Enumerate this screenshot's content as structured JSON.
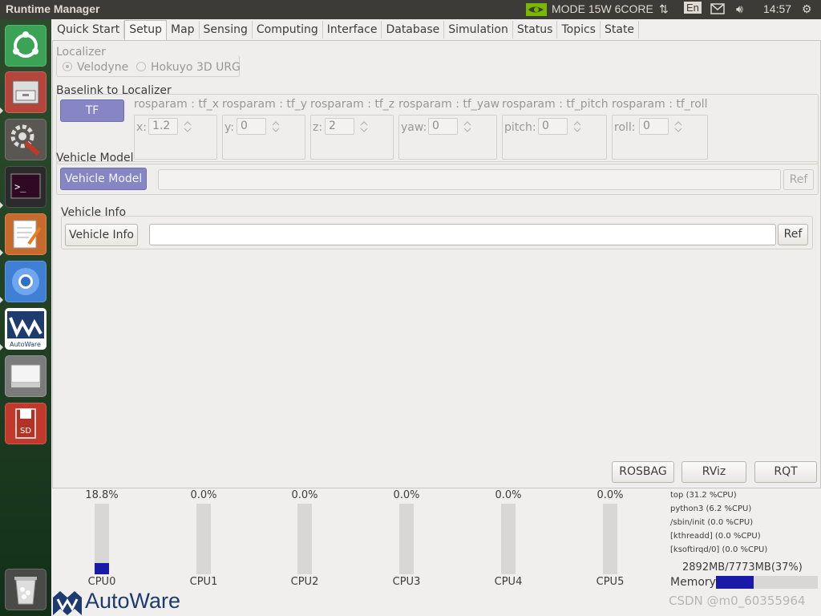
{
  "topbar": {
    "window_title": "Runtime Manager",
    "mode": "MODE 15W 6CORE",
    "lang": "En",
    "time": "14:57"
  },
  "tabs": [
    "Quick Start",
    "Setup",
    "Map",
    "Sensing",
    "Computing",
    "Interface",
    "Database",
    "Simulation",
    "Status",
    "Topics",
    "State"
  ],
  "active_tab": "Setup",
  "localizer": {
    "title": "Localizer",
    "options": [
      "Velodyne",
      "Hokuyo 3D URG"
    ],
    "selected": "Velodyne"
  },
  "baselink": {
    "title": "Baselink to Localizer",
    "tf_button": "TF",
    "params": [
      {
        "label": "rosparam : tf_x",
        "prefix": "x:",
        "value": "1.2"
      },
      {
        "label": "rosparam : tf_y",
        "prefix": "y:",
        "value": "0"
      },
      {
        "label": "rosparam : tf_z",
        "prefix": "z:",
        "value": "2"
      },
      {
        "label": "rosparam : tf_yaw",
        "prefix": "yaw:",
        "value": "0"
      },
      {
        "label": "rosparam : tf_pitch",
        "prefix": "pitch:",
        "value": "0"
      },
      {
        "label": "rosparam : tf_roll",
        "prefix": "roll:",
        "value": "0"
      }
    ]
  },
  "vehicle_model": {
    "title": "Vehicle Model",
    "button": "Vehicle Model",
    "path_value": "",
    "ref": "Ref"
  },
  "vehicle_info": {
    "title": "Vehicle Info",
    "button": "Vehicle Info",
    "path_value": "",
    "ref": "Ref"
  },
  "tools": {
    "rosbag": "ROSBAG",
    "rviz": "RViz",
    "rqt": "RQT"
  },
  "cpus": [
    {
      "name": "CPU0",
      "pct": "18.8%",
      "usage": 0.188
    },
    {
      "name": "CPU1",
      "pct": "0.0%",
      "usage": 0.0
    },
    {
      "name": "CPU2",
      "pct": "0.0%",
      "usage": 0.0
    },
    {
      "name": "CPU3",
      "pct": "0.0%",
      "usage": 0.0
    },
    {
      "name": "CPU4",
      "pct": "0.0%",
      "usage": 0.0
    },
    {
      "name": "CPU5",
      "pct": "0.0%",
      "usage": 0.0
    }
  ],
  "top_processes": [
    "top (31.2 %CPU)",
    "python3 (6.2 %CPU)",
    "/sbin/init (0.0 %CPU)",
    "[kthreadd] (0.0 %CPU)",
    "[ksoftirqd/0] (0.0 %CPU)"
  ],
  "memory": {
    "label": "Memory",
    "text": "2892MB/7773MB(37%)",
    "usage": 0.37
  },
  "brand": {
    "name": "AutoWare"
  },
  "launcher": [
    "Ubuntu",
    "Files",
    "System Settings",
    "Terminal",
    "Text Editor",
    "Chromium",
    "AutoWare",
    "Drive",
    "SD Card",
    "Trash"
  ],
  "watermark": "CSDN @m0_60355964",
  "colors": {
    "accent": "#8686c4",
    "cpu_fill": "#1a1aa8",
    "topbar": "#3c3b37"
  }
}
